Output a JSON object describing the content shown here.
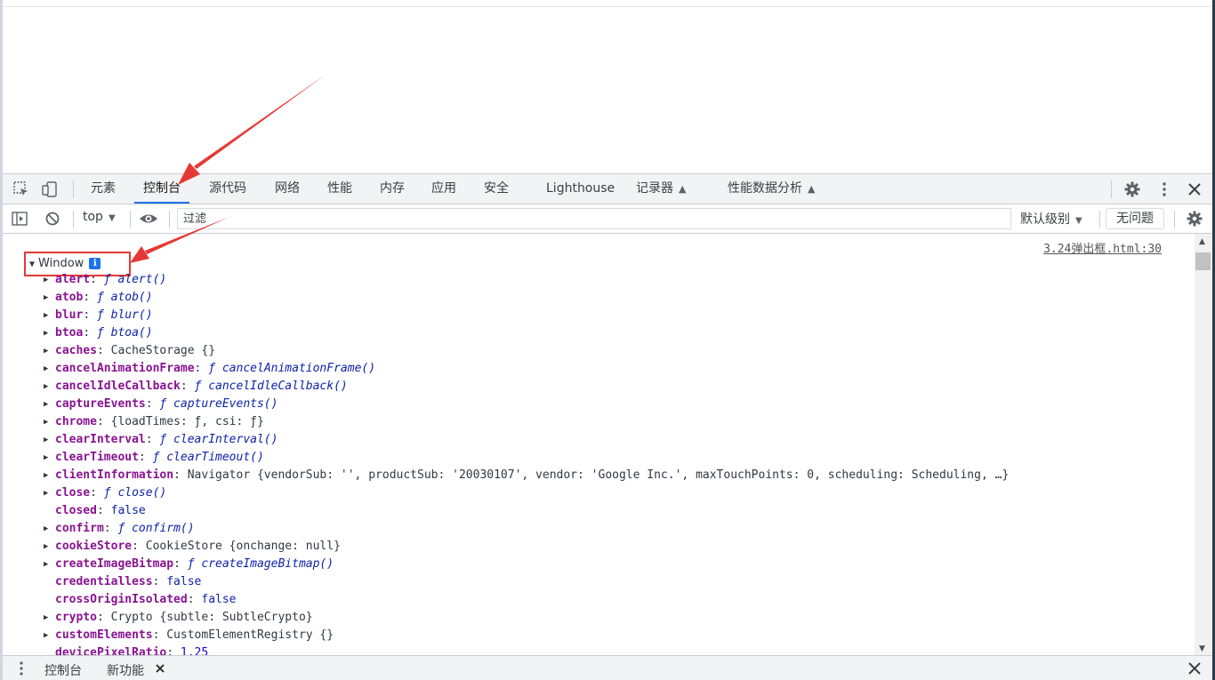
{
  "devtools": {
    "tabs": [
      {
        "label": "元素"
      },
      {
        "label": "控制台"
      },
      {
        "label": "源代码"
      },
      {
        "label": "网络"
      },
      {
        "label": "性能"
      },
      {
        "label": "内存"
      },
      {
        "label": "应用"
      },
      {
        "label": "安全"
      },
      {
        "label": "Lighthouse"
      },
      {
        "label": "记录器"
      },
      {
        "label": "性能数据分析"
      }
    ],
    "active_tab": "控制台",
    "console_toolbar": {
      "context": "top",
      "filter_placeholder": "过滤",
      "levels": "默认级别",
      "issues": "无问题"
    },
    "source_link": "3.24弹出框.html:30",
    "root_label": "Window",
    "info_badge": "i",
    "properties": [
      {
        "key": "alert",
        "value": "ƒ alert()"
      },
      {
        "key": "atob",
        "value": "ƒ atob()"
      },
      {
        "key": "blur",
        "value": "ƒ blur()"
      },
      {
        "key": "btoa",
        "value": "ƒ btoa()"
      },
      {
        "key": "caches",
        "value": "CacheStorage {}"
      },
      {
        "key": "cancelAnimationFrame",
        "value": "ƒ cancelAnimationFrame()"
      },
      {
        "key": "cancelIdleCallback",
        "value": "ƒ cancelIdleCallback()"
      },
      {
        "key": "captureEvents",
        "value": "ƒ captureEvents()"
      },
      {
        "key": "chrome",
        "value": "{loadTimes: ƒ, csi: ƒ}"
      },
      {
        "key": "clearInterval",
        "value": "ƒ clearInterval()"
      },
      {
        "key": "clearTimeout",
        "value": "ƒ clearTimeout()"
      },
      {
        "key": "clientInformation",
        "value": "Navigator {vendorSub: '', productSub: '20030107', vendor: 'Google Inc.', maxTouchPoints: 0, scheduling: Scheduling, …}"
      },
      {
        "key": "close",
        "value": "ƒ close()"
      },
      {
        "key": "closed",
        "value": "false"
      },
      {
        "key": "confirm",
        "value": "ƒ confirm()"
      },
      {
        "key": "cookieStore",
        "value": "CookieStore {onchange: null}"
      },
      {
        "key": "createImageBitmap",
        "value": "ƒ createImageBitmap()"
      },
      {
        "key": "credentialless",
        "value": "false"
      },
      {
        "key": "crossOriginIsolated",
        "value": "false"
      },
      {
        "key": "crypto",
        "value": "Crypto {subtle: SubtleCrypto}"
      },
      {
        "key": "customElements",
        "value": "CustomElementRegistry {}"
      },
      {
        "key": "devicePixelRatio",
        "value": "1.25"
      }
    ],
    "drawer": {
      "tabs": [
        {
          "label": "控制台"
        },
        {
          "label": "新功能"
        }
      ]
    },
    "colors": {
      "accent": "#1a73e8",
      "annotation": "#e53935",
      "property_key": "#881391"
    }
  }
}
